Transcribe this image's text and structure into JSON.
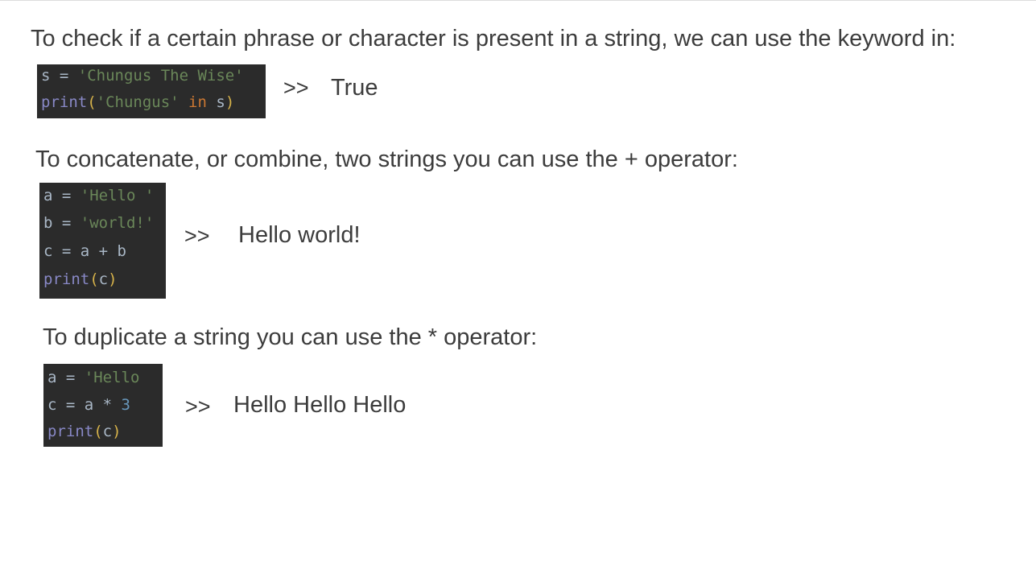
{
  "sections": [
    {
      "heading": "To check if a certain phrase or character is present in a string, we can use the keyword in:",
      "code": {
        "line1": {
          "var": "s",
          "eq": " = ",
          "str": "'Chungus The Wise'"
        },
        "line2": {
          "fn": "print",
          "open": "(",
          "str": "'Chungus'",
          "kw": " in ",
          "var": "s",
          "close": ")"
        }
      },
      "prompt": ">>",
      "output": "True"
    },
    {
      "heading": "To concatenate, or combine, two strings you can use the + operator:",
      "code": {
        "line1": {
          "var": "a",
          "eq": " = ",
          "str": "'Hello '"
        },
        "line2": {
          "var": "b",
          "eq": " = ",
          "str": "'world!'"
        },
        "line3": {
          "text": "c = a + b"
        },
        "line4": {
          "fn": "print",
          "open": "(",
          "var": "c",
          "close": ")"
        }
      },
      "prompt": ">>",
      "output": "Hello world!"
    },
    {
      "heading": "To duplicate a string you can use the * operator:",
      "code": {
        "line1": {
          "var": "a",
          "eq": " = ",
          "str": "'Hello"
        },
        "line2": {
          "text": "c = a * ",
          "num": "3"
        },
        "line3": {
          "fn": "print",
          "open": "(",
          "var": "c",
          "close": ")"
        }
      },
      "prompt": ">>",
      "output": "Hello Hello Hello"
    }
  ]
}
